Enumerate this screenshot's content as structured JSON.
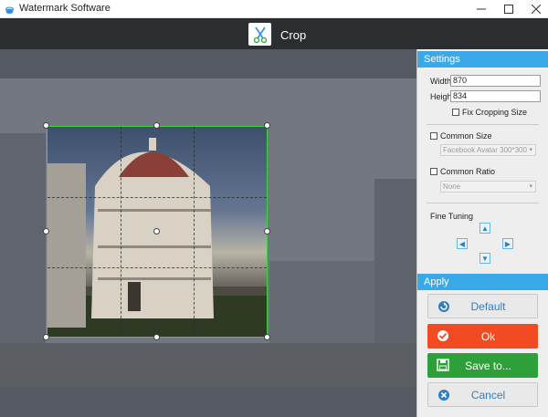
{
  "window": {
    "title": "Watermark Software"
  },
  "header": {
    "title": "Crop"
  },
  "settings": {
    "section_title": "Settings",
    "width_label": "Width:",
    "width_value": "870",
    "height_label": "Height:",
    "height_value": "834",
    "fix_cropping_label": "Fix Cropping Size",
    "common_size_label": "Common Size",
    "common_size_value": "Facebook Avatar 300*300",
    "common_ratio_label": "Common Ratio",
    "common_ratio_value": "None",
    "fine_tuning_label": "Fine Tuning"
  },
  "apply": {
    "section_title": "Apply",
    "default_label": "Default",
    "ok_label": "Ok",
    "save_label": "Save to...",
    "cancel_label": "Cancel"
  },
  "colors": {
    "accent": "#3aa9e8",
    "crop_border": "#3cd43c",
    "ok": "#f04b23",
    "save": "#2ea03a",
    "header": "#2b2d30"
  }
}
